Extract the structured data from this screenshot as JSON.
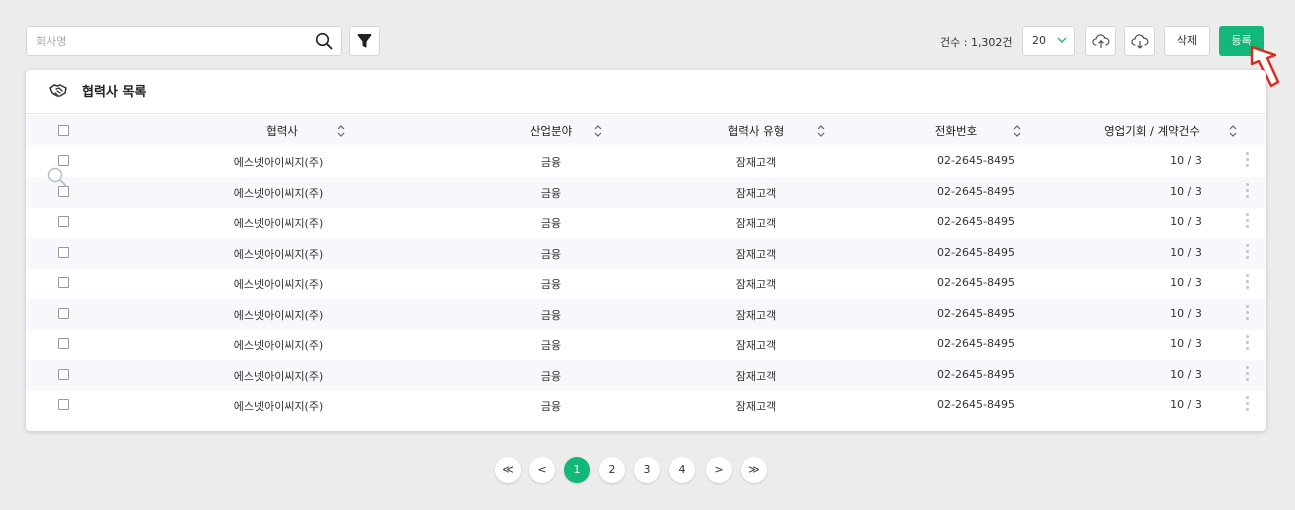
{
  "toolbar": {
    "search_placeholder": "회사명",
    "count_label": "건수 : 1,302건",
    "page_size": "20",
    "delete_label": "삭제",
    "register_label": "등록",
    "accent_color": "#13b779"
  },
  "panel": {
    "title": "협력사 목록",
    "icon": "handshake-icon"
  },
  "table": {
    "columns": [
      "협력사",
      "산업분야",
      "협력사 유형",
      "전화번호",
      "영업기회 / 계약건수"
    ],
    "rows": [
      {
        "company": "에스넷아이씨지(주)",
        "industry": "금융",
        "type": "잠재고객",
        "phone": "02-2645-8495",
        "count": "10 / 3"
      },
      {
        "company": "에스넷아이씨지(주)",
        "industry": "금융",
        "type": "잠재고객",
        "phone": "02-2645-8495",
        "count": "10 / 3"
      },
      {
        "company": "에스넷아이씨지(주)",
        "industry": "금융",
        "type": "잠재고객",
        "phone": "02-2645-8495",
        "count": "10 / 3"
      },
      {
        "company": "에스넷아이씨지(주)",
        "industry": "금융",
        "type": "잠재고객",
        "phone": "02-2645-8495",
        "count": "10 / 3"
      },
      {
        "company": "에스넷아이씨지(주)",
        "industry": "금융",
        "type": "잠재고객",
        "phone": "02-2645-8495",
        "count": "10 / 3"
      },
      {
        "company": "에스넷아이씨지(주)",
        "industry": "금융",
        "type": "잠재고객",
        "phone": "02-2645-8495",
        "count": "10 / 3"
      },
      {
        "company": "에스넷아이씨지(주)",
        "industry": "금융",
        "type": "잠재고객",
        "phone": "02-2645-8495",
        "count": "10 / 3"
      },
      {
        "company": "에스넷아이씨지(주)",
        "industry": "금융",
        "type": "잠재고객",
        "phone": "02-2645-8495",
        "count": "10 / 3"
      },
      {
        "company": "에스넷아이씨지(주)",
        "industry": "금융",
        "type": "잠재고객",
        "phone": "02-2645-8495",
        "count": "10 / 3"
      }
    ]
  },
  "pagination": {
    "first": "≪",
    "prev": "<",
    "pages": [
      "1",
      "2",
      "3",
      "4"
    ],
    "current": "1",
    "next": ">",
    "last": "≫"
  }
}
